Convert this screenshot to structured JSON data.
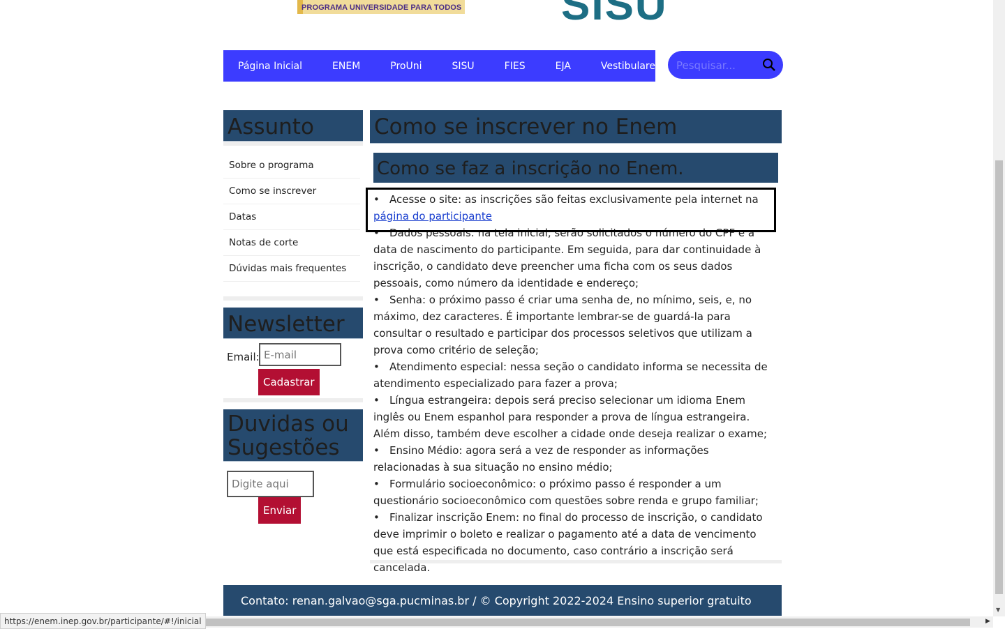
{
  "logos": {
    "prouni_subtitle": "PROGRAMA UNIVERSIDADE PARA TODOS",
    "sisu": "SISU"
  },
  "nav": {
    "items": [
      "Página Inicial",
      "ENEM",
      "ProUni",
      "SISU",
      "FIES",
      "EJA",
      "Vestibulares"
    ]
  },
  "search": {
    "placeholder": "Pesquisar..."
  },
  "sidebar": {
    "assunto_title": "Assunto",
    "menu": [
      "Sobre o programa",
      "Como se inscrever",
      "Datas",
      "Notas de corte",
      "Dúvidas mais frequentes"
    ],
    "newsletter_title": "Newsletter",
    "email_label": "Email:",
    "email_placeholder": "E-mail",
    "subscribe_label": "Cadastrar",
    "feedback_title": "Duvidas ou Sugestões",
    "feedback_placeholder": "Digite aqui",
    "send_label": "Enviar"
  },
  "main": {
    "title": "Como se inscrever no Enem",
    "subtitle": "Como se faz a inscrição no Enem.",
    "first_item_text": "Acesse o site: as inscrições são feitas exclusivamente pela internet na ",
    "first_item_link": "página do participante",
    "items": [
      "Dados pessoais: na tela inicial, serão solicitados o número do CPF e a data de nascimento do participante. Em seguida, para dar continuidade à inscrição, o candidato deve preencher uma ficha com os seus dados pessoais, como número da identidade e endereço;",
      "Senha: o próximo passo é criar uma senha de, no mínimo, seis, e, no máximo, dez caracteres. É importante lembrar-se de guardá-la para consultar o resultado e participar dos processos seletivos que utilizam a prova como critério de seleção;",
      "Atendimento especial: nessa seção o candidato informa se necessita de atendimento especializado para fazer a prova;",
      "Língua estrangeira: depois será preciso selecionar um idioma Enem inglês ou Enem espanhol para responder a prova de língua estrangeira. Além disso, também deve escolher a cidade onde deseja realizar o exame;",
      "Ensino Médio: agora será a vez de responder as informações relacionadas à sua situação no ensino médio;",
      "Formulário socioeconômico: o próximo passo é responder a um questionário socioeconômico com questões sobre renda e grupo familiar;",
      "Finalizar inscrição Enem: no final do processo de inscrição, o candidato deve imprimir o boleto e realizar o pagamento até a data de vencimento que está especificada no documento, caso contrário a inscrição será cancelada."
    ]
  },
  "footer": {
    "text": "Contato: renan.galvao@sga.pucminas.br / © Copyright 2022-2024 Ensino superior gratuito"
  },
  "status_bar": {
    "url": "https://enem.inep.gov.br/participante/#!/inicial"
  },
  "colors": {
    "nav": "#3c3cff",
    "box": "#264a6e",
    "button": "#b30f33",
    "link": "#1a3fcf"
  }
}
